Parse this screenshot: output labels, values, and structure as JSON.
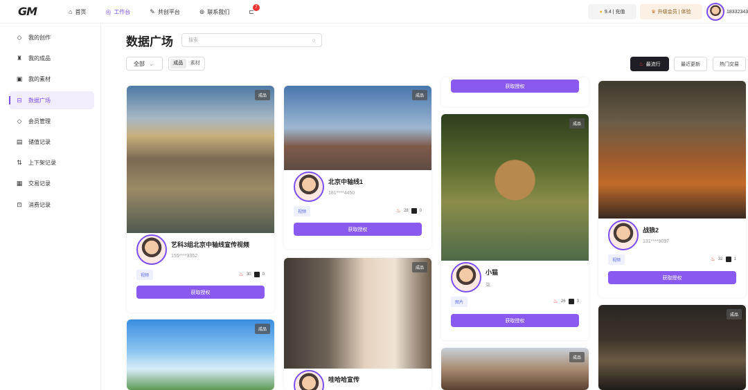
{
  "header": {
    "logo": "GM",
    "nav": [
      {
        "icon": "⌂",
        "label": "首页"
      },
      {
        "icon": "◎",
        "label": "工作台"
      },
      {
        "icon": "✎",
        "label": "共创平台"
      },
      {
        "icon": "⊚",
        "label": "联系我们"
      }
    ],
    "notice_badge": "7",
    "recharge": "9.4 | 充值",
    "membership": "升级会员 | 体验",
    "user_phone": "18332343"
  },
  "sidebar": [
    {
      "icon": "◇",
      "label": "我的创作"
    },
    {
      "icon": "♜",
      "label": "我的成品"
    },
    {
      "icon": "▣",
      "label": "我的素材"
    },
    {
      "icon": "⊟",
      "label": "数据广场"
    },
    {
      "icon": "◇",
      "label": "会员管理"
    },
    {
      "icon": "▤",
      "label": "储值记录"
    },
    {
      "icon": "⇅",
      "label": "上下架记录"
    },
    {
      "icon": "▦",
      "label": "交易记录"
    },
    {
      "icon": "⊡",
      "label": "消费记录"
    }
  ],
  "main": {
    "title": "数据广场",
    "search_placeholder": "搜索",
    "filter": "全部",
    "segments": [
      "成品",
      "素材"
    ],
    "sort": [
      "最流行",
      "最近更新",
      "热门交易"
    ]
  },
  "cards": [
    {
      "tag": "成品",
      "title": "艺科3组北京中轴线宣传视频",
      "phone": "155****3352",
      "type": "视频",
      "likes": "30",
      "comments": "0",
      "button": "获取授权"
    },
    {
      "tag": "成品"
    },
    {
      "tag": "成品",
      "title": "北京中轴线1",
      "phone": "181****4450",
      "type": "视频",
      "likes": "28",
      "comments": "0",
      "button": "获取授权"
    },
    {
      "tag": "成品",
      "title": "哇哈哈宣传"
    },
    {
      "button": "获取授权"
    },
    {
      "tag": "成品",
      "title": "小猫",
      "phone": "柒",
      "type": "图片",
      "likes": "26",
      "comments": "3",
      "button": "获取授权"
    },
    {
      "tag": "成品"
    },
    {
      "title": "战狼2",
      "phone": "131****9097",
      "type": "视频",
      "likes": "32",
      "comments": "1",
      "button": "获取授权"
    },
    {
      "tag": "成品"
    }
  ],
  "colors": {
    "accent": "#8a59f0"
  }
}
